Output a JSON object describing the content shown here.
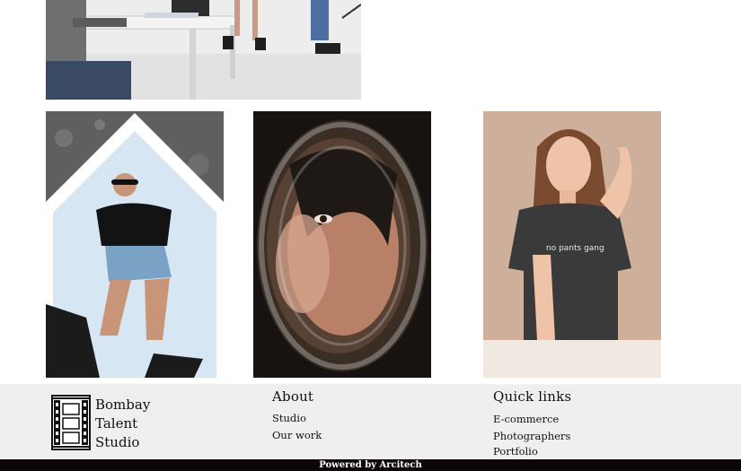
{
  "gallery": {
    "top_photo": {
      "description_icon": "photo-studio-session-image"
    },
    "photos": [
      {
        "icon": "model-on-mirror-photo"
      },
      {
        "icon": "model-through-glass-photo"
      },
      {
        "icon": "model-in-tshirt-photo",
        "shirt_text": "no pants gang"
      }
    ]
  },
  "footer": {
    "logo": {
      "icon": "film-strip-icon",
      "lines": [
        "Bombay",
        "Talent",
        "Studio"
      ]
    },
    "about": {
      "title": "About",
      "links": [
        "Studio",
        "Our work"
      ]
    },
    "quick_links": {
      "title": "Quick links",
      "links": [
        "E-commerce",
        "Photographers",
        "Portfolio"
      ]
    }
  },
  "bottom_bar": {
    "text": "Powered by Arcitech"
  },
  "colors": {
    "footer_bg": "#efefef",
    "bottom_bar_bg": "#0d0606"
  }
}
